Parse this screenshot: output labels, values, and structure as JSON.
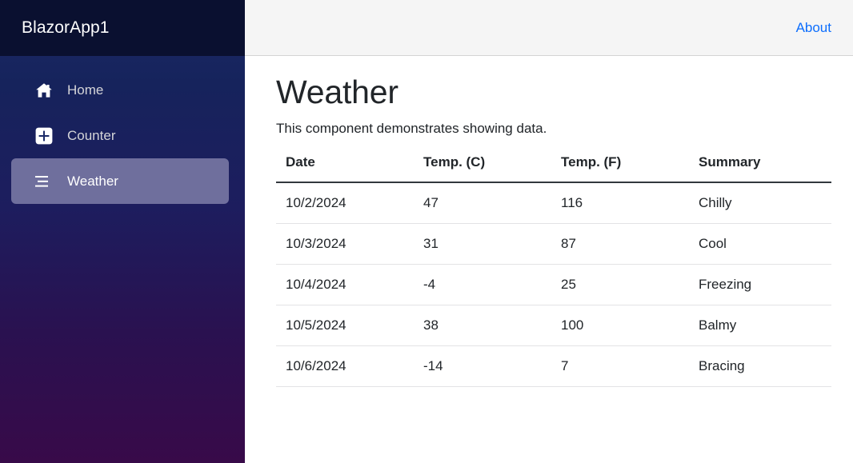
{
  "sidebar": {
    "brand": "BlazorApp1",
    "items": [
      {
        "label": "Home",
        "icon": "house-icon",
        "active": false
      },
      {
        "label": "Counter",
        "icon": "plus-square-icon",
        "active": false
      },
      {
        "label": "Weather",
        "icon": "list-icon",
        "active": true
      }
    ]
  },
  "header": {
    "about_label": "About"
  },
  "page": {
    "title": "Weather",
    "subtitle": "This component demonstrates showing data."
  },
  "table": {
    "columns": [
      "Date",
      "Temp. (C)",
      "Temp. (F)",
      "Summary"
    ],
    "rows": [
      {
        "date": "10/2/2024",
        "temp_c": "47",
        "temp_f": "116",
        "summary": "Chilly"
      },
      {
        "date": "10/3/2024",
        "temp_c": "31",
        "temp_f": "87",
        "summary": "Cool"
      },
      {
        "date": "10/4/2024",
        "temp_c": "-4",
        "temp_f": "25",
        "summary": "Freezing"
      },
      {
        "date": "10/5/2024",
        "temp_c": "38",
        "temp_f": "100",
        "summary": "Balmy"
      },
      {
        "date": "10/6/2024",
        "temp_c": "-14",
        "temp_f": "7",
        "summary": "Bracing"
      }
    ]
  },
  "colors": {
    "sidebar_top": "#1b2a67",
    "sidebar_bottom": "#380a49",
    "brand_bar": "#0a1030",
    "active_nav": "#6f6f9d",
    "link_blue": "#0d6efd",
    "topbar_bg": "#f5f5f5",
    "text": "#212529"
  }
}
